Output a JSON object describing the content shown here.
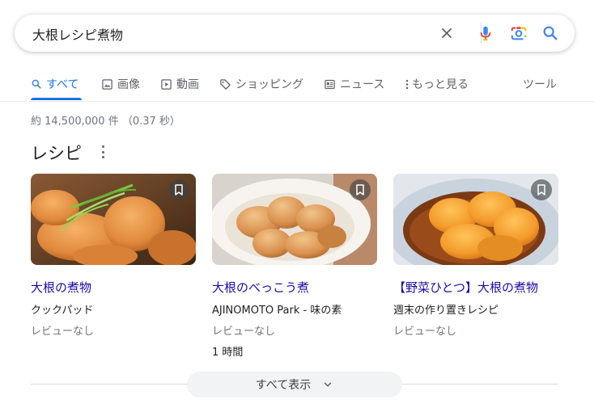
{
  "search": {
    "query": "大根レシピ煮物",
    "icons": [
      "close-icon",
      "mic-icon",
      "lens-camera-icon",
      "search-icon"
    ]
  },
  "tabs": [
    {
      "label": "すべて",
      "icon": "search-icon",
      "active": true
    },
    {
      "label": "画像",
      "icon": "image-icon"
    },
    {
      "label": "動画",
      "icon": "play-icon"
    },
    {
      "label": "ショッピング",
      "icon": "tag-icon"
    },
    {
      "label": "ニュース",
      "icon": "news-icon"
    },
    {
      "label": "もっと見る",
      "icon": "more-vert-icon"
    },
    {
      "label": "ツール"
    }
  ],
  "stats": "約 14,500,000 件 （0.37 秒）",
  "recipes": {
    "title": "レシピ",
    "cards": [
      {
        "title": "大根の煮物",
        "source": "クックパッド",
        "review": "レビューなし"
      },
      {
        "title": "大根のべっこう煮",
        "source": "AJINOMOTO Park - 味の素",
        "review": "レビューなし",
        "time": "1 時間"
      },
      {
        "title": "【野菜ひとつ】大根の煮物",
        "source": "週末の作り置きレシピ",
        "review": "レビューなし"
      }
    ],
    "show_all": "すべて表示"
  },
  "colors": {
    "link": "#1a0dab",
    "accent": "#1a73e8",
    "muted": "#70757a"
  }
}
